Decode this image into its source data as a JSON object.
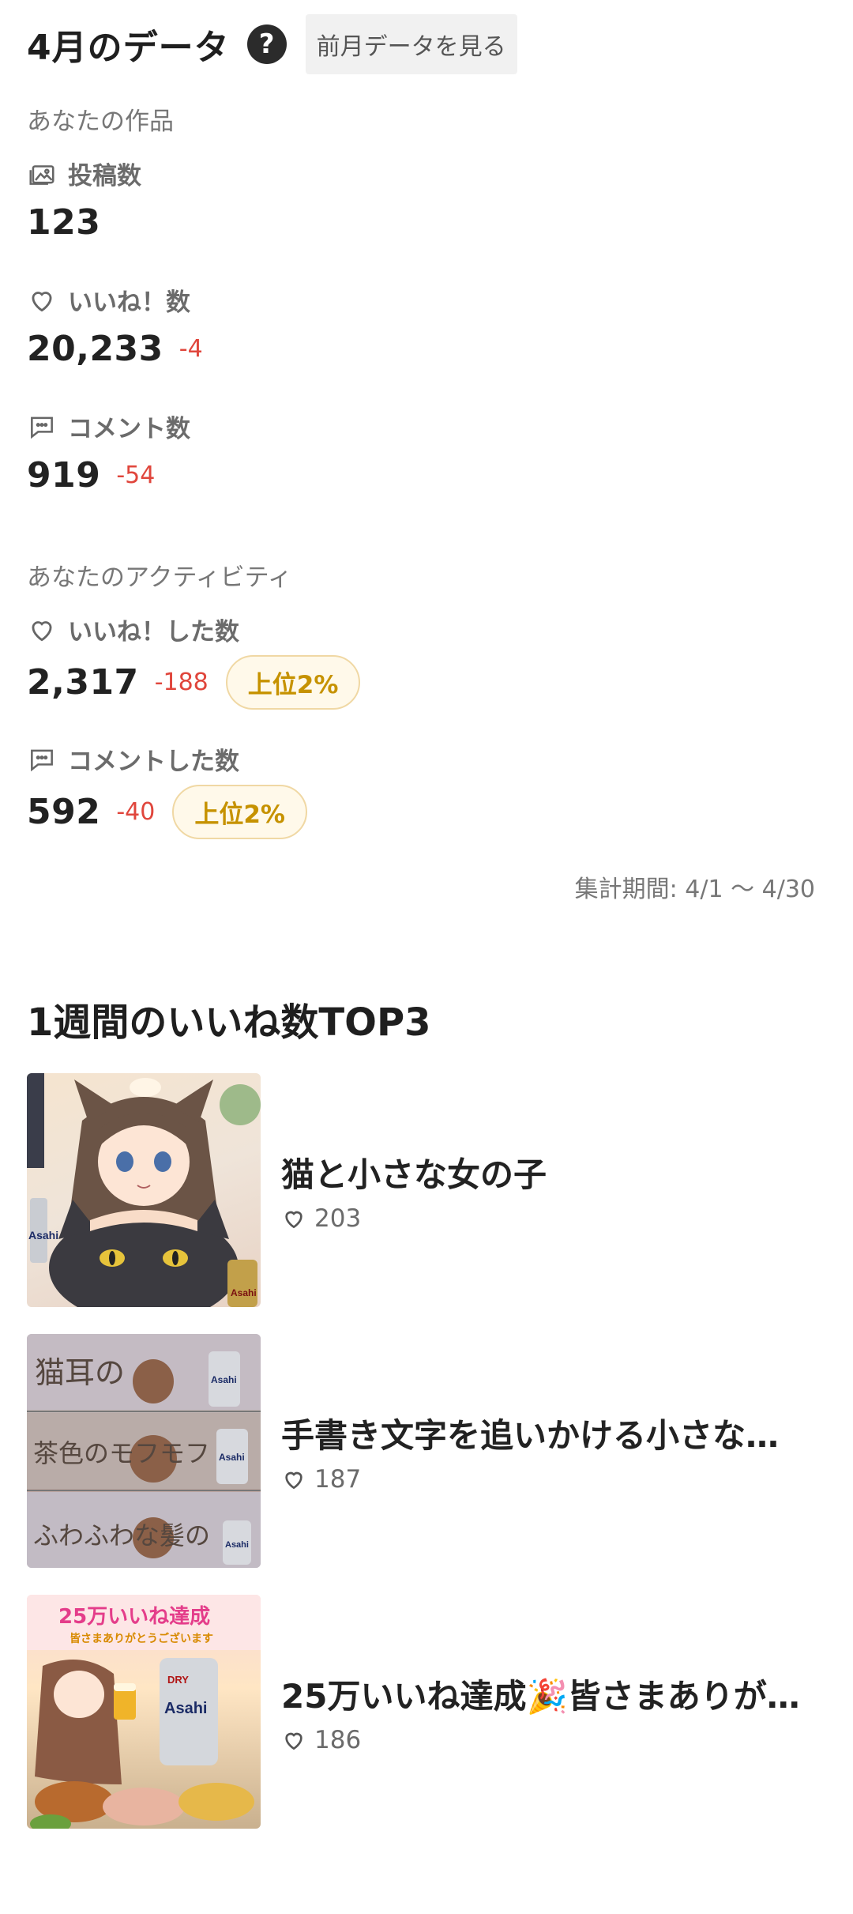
{
  "header": {
    "title": "4月のデータ",
    "help_glyph": "?",
    "prev_button": "前月データを見る"
  },
  "works_section": {
    "title": "あなたの作品",
    "metrics": [
      {
        "label": "投稿数",
        "icon": "gallery-icon",
        "value": "123",
        "delta": ""
      },
      {
        "label": "いいね！数",
        "icon": "heart-icon",
        "value": "20,233",
        "delta": "-4"
      },
      {
        "label": "コメント数",
        "icon": "comment-icon",
        "value": "919",
        "delta": "-54"
      }
    ]
  },
  "activity_section": {
    "title": "あなたのアクティビティ",
    "metrics": [
      {
        "label": "いいね！した数",
        "icon": "heart-icon",
        "value": "2,317",
        "delta": "-188",
        "rank": "上位2%"
      },
      {
        "label": "コメントした数",
        "icon": "comment-icon",
        "value": "592",
        "delta": "-40",
        "rank": "上位2%"
      }
    ]
  },
  "period": "集計期間: 4/1 〜 4/30",
  "top3": {
    "title": "1週間のいいね数TOP3",
    "items": [
      {
        "title": "猫と小さな女の子",
        "likes": "203"
      },
      {
        "title": "手書き文字を追いかける小さな…",
        "likes": "187"
      },
      {
        "title": "25万いいね達成🎉皆さまありが…",
        "likes": "186"
      }
    ]
  },
  "thumbnails": {
    "image2_lines": [
      "猫耳の",
      "茶色のモフモフ",
      "ふわふわな髪の"
    ],
    "image3_banner": "25万いいね達成",
    "image3_sub": "皆さまありがとうございます",
    "brand": "Asahi",
    "brand_sub": "DRY"
  },
  "colors": {
    "delta": "#e0463c",
    "rank_text": "#c69200",
    "rank_bg": "#fff9ea",
    "rank_border": "#f0d8a4"
  }
}
